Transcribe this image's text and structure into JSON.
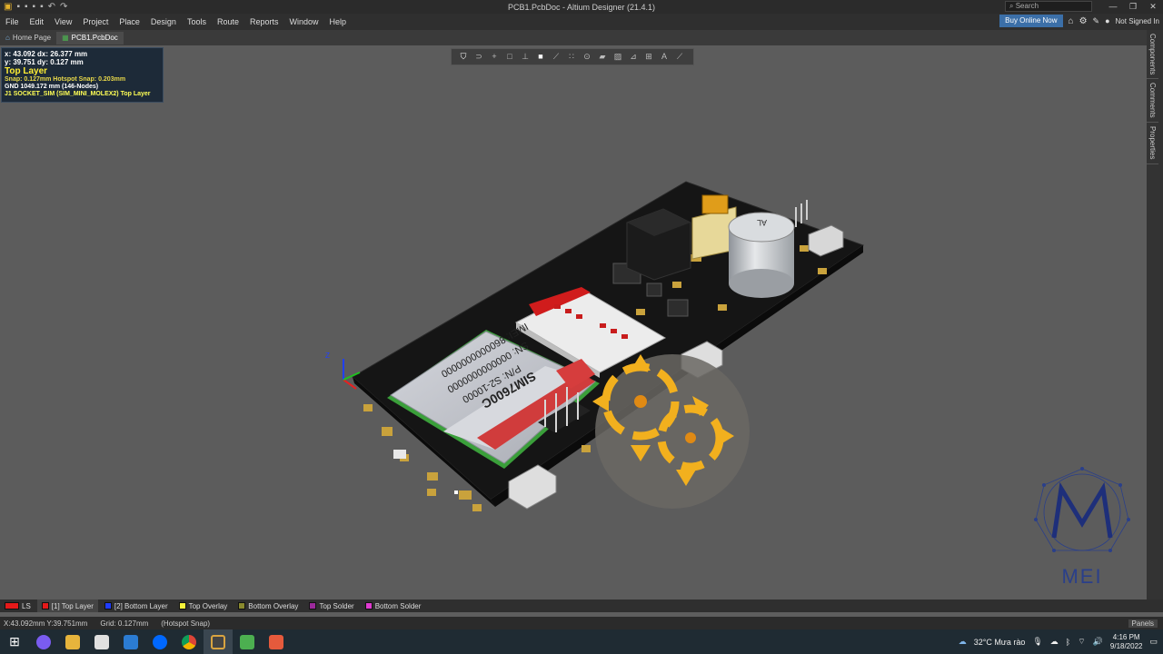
{
  "window": {
    "title": "PCB1.PcbDoc - Altium Designer (21.4.1)",
    "search_placeholder": "Search"
  },
  "menu": {
    "items": [
      "File",
      "Edit",
      "View",
      "Project",
      "Place",
      "Design",
      "Tools",
      "Route",
      "Reports",
      "Window",
      "Help"
    ],
    "buy_label": "Buy Online Now",
    "signin_label": "Not Signed In"
  },
  "tabs": [
    {
      "label": "Home Page"
    },
    {
      "label": "PCB1.PcbDoc"
    }
  ],
  "right_panels": [
    "Components",
    "Comments",
    "Properties"
  ],
  "hud": {
    "line1": "x: 43.092   dx: 26.377  mm",
    "line2": "y: 39.751   dy:  0.127  mm",
    "layer": "Top Layer",
    "snap": "Snap: 0.127mm Hotspot Snap: 0.203mm",
    "net": "GND 1049.172 mm (146-Nodes)",
    "component": "J1  SOCKET_SIM (SIM_MINI_MOLEX2)  Top Layer"
  },
  "board": {
    "module_line1": "SIM7600C",
    "module_line2": "P/N: S2-10000",
    "module_line3": "SN: 0000000000000",
    "module_line4": "IMEI: 8600000000000",
    "cap_label": "AL"
  },
  "layers": [
    {
      "label": "LS",
      "color": "#e51a1a"
    },
    {
      "label": "[1] Top Layer",
      "color": "#e51a1a"
    },
    {
      "label": "[2] Bottom Layer",
      "color": "#1f3cff"
    },
    {
      "label": "Top Overlay",
      "color": "#f5f23a"
    },
    {
      "label": "Bottom Overlay",
      "color": "#8a8a2e"
    },
    {
      "label": "Top Solder",
      "color": "#9b2a9b"
    },
    {
      "label": "Bottom Solder",
      "color": "#e03ad0"
    }
  ],
  "status": {
    "coords": "X:43.092mm Y:39.751mm",
    "grid": "Grid: 0.127mm",
    "snap": "(Hotspot Snap)",
    "panels": "Panels"
  },
  "taskbar": {
    "weather": "32°C  Mưa rào",
    "time": "4:16 PM",
    "date": "9/18/2022"
  },
  "logo": {
    "text": "MEI"
  }
}
